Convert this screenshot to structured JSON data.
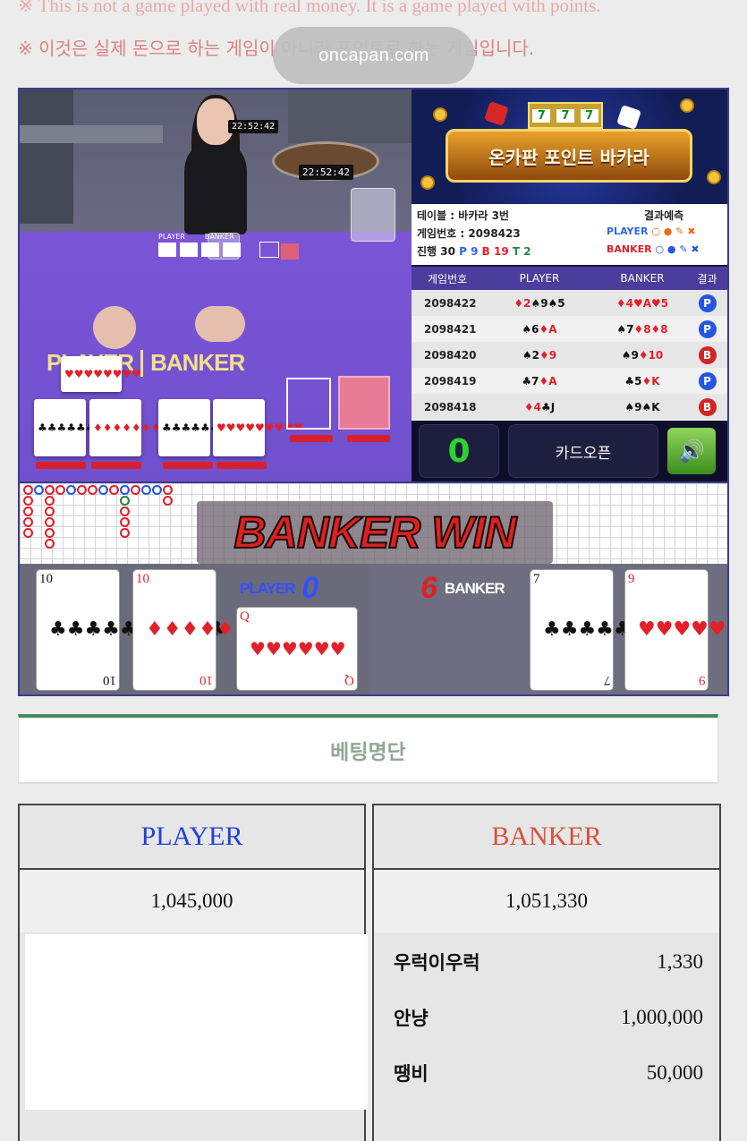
{
  "notice": {
    "en": "※ This is not a game played with real money. It is a game played with points.",
    "ko": "※ 이것은 실제 돈으로 하는 게임이 아니라 포인트로 하는 게임입니다."
  },
  "watermark": "oncapan.com",
  "video": {
    "clock1": "22:52:42",
    "clock2": "22:52:42",
    "sign_player": "PLAYER",
    "sign_banker": "BANKER"
  },
  "banner": {
    "title": "온카판 포인트 바카라",
    "slot": [
      "7",
      "7",
      "7"
    ]
  },
  "info": {
    "table": "테이블 : 바카라 3번",
    "game_no": "게임번호 : 2098423",
    "progress_label": "진행 30",
    "p_count": "P 9",
    "b_count": "B 19",
    "t_count": "T 2",
    "prediction_title": "결과예측",
    "pred_player_label": "PLAYER",
    "pred_banker_label": "BANKER",
    "pred_player_symbols": "○ ● ✎ ✖",
    "pred_banker_symbols": "○ ● ✎ ✖"
  },
  "history": {
    "headers": [
      "게임번호",
      "PLAYER",
      "BANKER",
      "결과"
    ],
    "rows": [
      {
        "no": "2098422",
        "player": "♦2♠9♠5",
        "banker": "♦4♥A♥5",
        "result": "P"
      },
      {
        "no": "2098421",
        "player": "♠6♦A",
        "banker": "♠7♦8♦8",
        "result": "P"
      },
      {
        "no": "2098420",
        "player": "♠2♦9",
        "banker": "♠9♦10",
        "result": "B"
      },
      {
        "no": "2098419",
        "player": "♣7♦A",
        "banker": "♣5♦K",
        "result": "P"
      },
      {
        "no": "2098418",
        "player": "♦4♣J",
        "banker": "♠9♠K",
        "result": "B"
      }
    ]
  },
  "controls": {
    "counter": "0",
    "card_open": "카드오픈",
    "sound_icon": "speaker-icon"
  },
  "result_banner": "BANKER WIN",
  "reveal": {
    "player_label": "PLAYER",
    "player_score": "0",
    "banker_label": "BANKER",
    "banker_score": "6",
    "player_cards": [
      {
        "rank": "10",
        "suit": "♣",
        "color": "black"
      },
      {
        "rank": "10",
        "suit": "♦",
        "color": "red"
      },
      {
        "rank": "Q",
        "suit": "♥",
        "color": "red"
      }
    ],
    "banker_cards": [
      {
        "rank": "7",
        "suit": "♣",
        "color": "black"
      },
      {
        "rank": "9",
        "suit": "♥",
        "color": "red"
      }
    ]
  },
  "betting": {
    "title": "베팅명단",
    "player_header": "PLAYER",
    "banker_header": "BANKER",
    "player_total": "1,045,000",
    "banker_total": "1,051,330",
    "player_color": "#1f3fe0",
    "banker_color": "#d9503c",
    "banker_bettors": [
      {
        "name": "우럭이우럭",
        "amount": "1,330"
      },
      {
        "name": "안냥",
        "amount": "1,000,000"
      },
      {
        "name": "땡비",
        "amount": "50,000"
      }
    ]
  }
}
